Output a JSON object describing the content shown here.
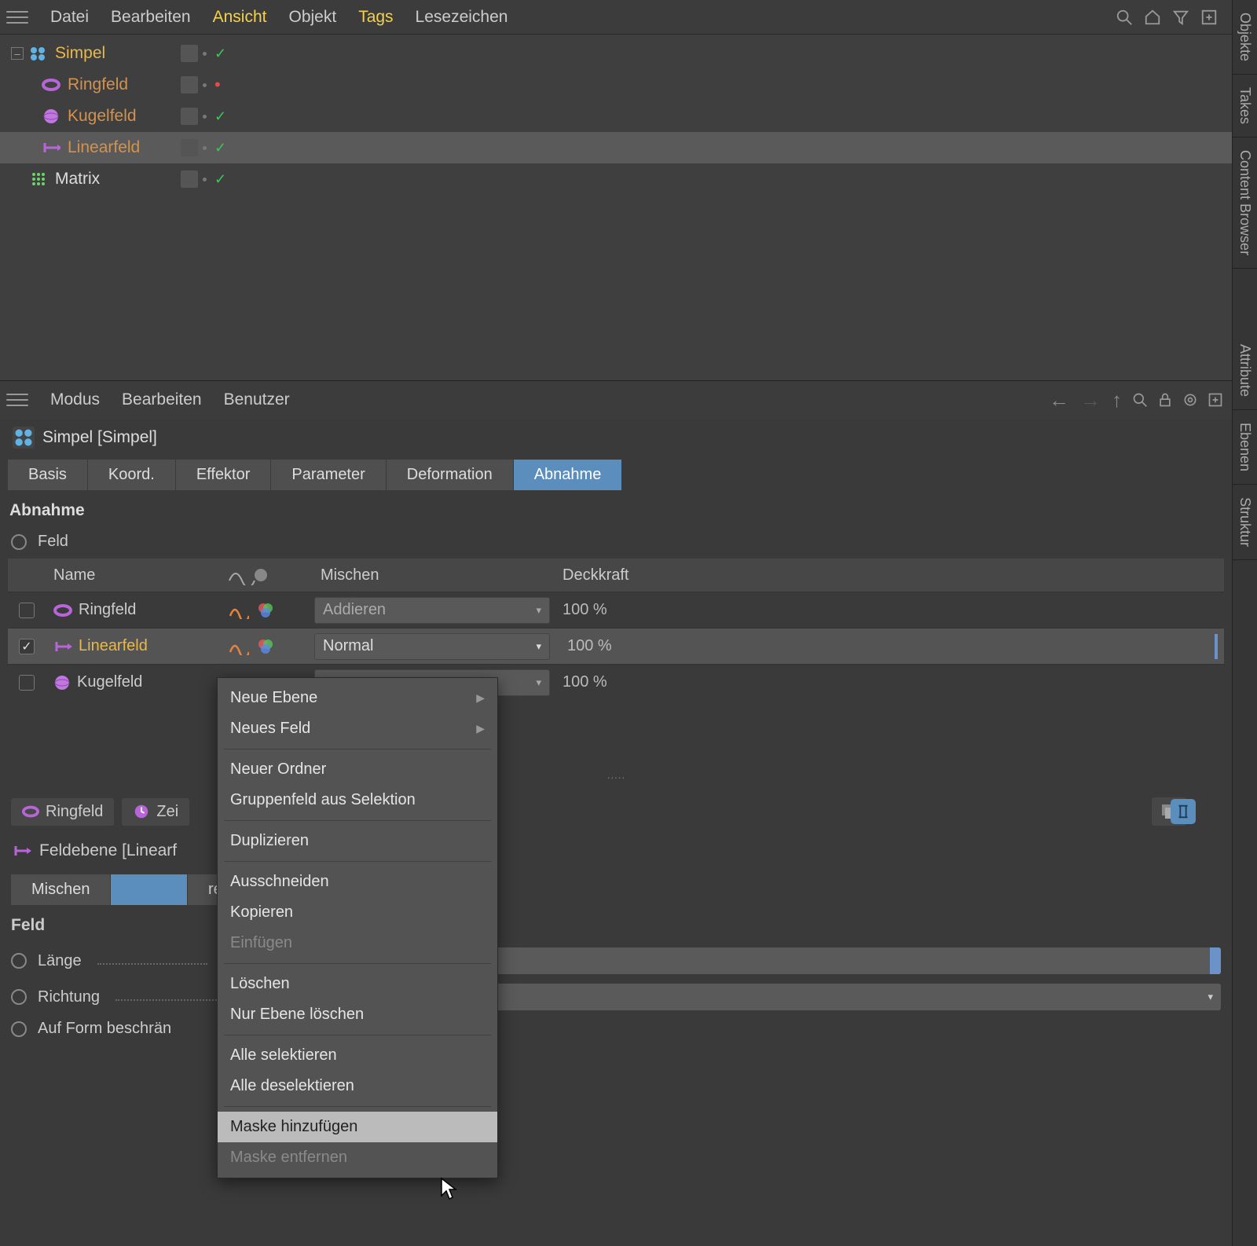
{
  "objectPanel": {
    "menu": {
      "datei": "Datei",
      "bearbeiten": "Bearbeiten",
      "ansicht": "Ansicht",
      "objekt": "Objekt",
      "tags": "Tags",
      "lesezeichen": "Lesezeichen"
    },
    "tree": [
      {
        "name": "Simpel",
        "color": "yellow",
        "level": 1,
        "status": "check",
        "expanded": true
      },
      {
        "name": "Ringfeld",
        "color": "orange",
        "level": 2,
        "status": "reddot"
      },
      {
        "name": "Kugelfeld",
        "color": "orange",
        "level": 2,
        "status": "check"
      },
      {
        "name": "Linearfeld",
        "color": "orange",
        "level": 2,
        "status": "check",
        "selected": true
      },
      {
        "name": "Matrix",
        "color": "white",
        "level": 1,
        "status": "check"
      }
    ]
  },
  "sideTabs": {
    "objekte": "Objekte",
    "takes": "Takes",
    "content": "Content Browser",
    "attribute": "Attribute",
    "ebenen": "Ebenen",
    "struktur": "Struktur"
  },
  "attrPanel": {
    "menu": {
      "modus": "Modus",
      "bearbeiten": "Bearbeiten",
      "benutzer": "Benutzer"
    },
    "title": "Simpel [Simpel]",
    "tabs": {
      "basis": "Basis",
      "koord": "Koord.",
      "effektor": "Effektor",
      "parameter": "Parameter",
      "deformation": "Deformation",
      "abnahme": "Abnahme"
    },
    "section": "Abnahme",
    "radio_feld": "Feld",
    "table": {
      "hdr_name": "Name",
      "hdr_mix": "Mischen",
      "hdr_op": "Deckkraft",
      "rows": [
        {
          "name": "Ringfeld",
          "mix": "Addieren",
          "op": "100 %",
          "checked": false,
          "selected": false,
          "icon": "ring"
        },
        {
          "name": "Linearfeld",
          "mix": "Normal",
          "op": "100 %",
          "checked": true,
          "selected": true,
          "icon": "linear"
        },
        {
          "name": "Kugelfeld",
          "mix": "",
          "op": "100 %",
          "checked": false,
          "selected": false,
          "icon": "sphere"
        }
      ]
    },
    "sec_ring": "Ringfeld",
    "sec_zei": "Zei",
    "layer_title": "Feldebene [Linearf",
    "layer_tabs": {
      "mischen": "Mischen",
      "remapping": "remapping"
    },
    "feld_label": "Feld",
    "prop_laenge": "Länge",
    "prop_richtung": "Richtung",
    "prop_aufform": "Auf Form beschrän"
  },
  "contextMenu": {
    "neue_ebene": "Neue Ebene",
    "neues_feld": "Neues Feld",
    "neuer_ordner": "Neuer Ordner",
    "gruppenfeld": "Gruppenfeld aus Selektion",
    "duplizieren": "Duplizieren",
    "ausschneiden": "Ausschneiden",
    "kopieren": "Kopieren",
    "einfuegen": "Einfügen",
    "loeschen": "Löschen",
    "nur_ebene_loeschen": "Nur Ebene löschen",
    "alle_selektieren": "Alle selektieren",
    "alle_deselektieren": "Alle deselektieren",
    "maske_hinzu": "Maske hinzufügen",
    "maske_entf": "Maske entfernen"
  },
  "colors": {
    "accent": "#5b8ebd",
    "warn": "#e8b948"
  }
}
